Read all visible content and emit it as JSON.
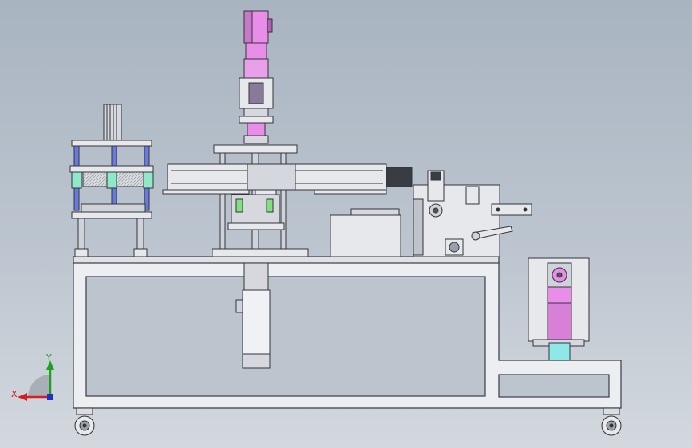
{
  "axes": {
    "x_label": "X",
    "y_label": "Y",
    "colors": {
      "x": "#d42020",
      "y": "#20a020",
      "z": "#2030c8"
    }
  },
  "colors": {
    "frame": "#ecedf0",
    "outline": "#3a3c44",
    "motor": "#e88ee8",
    "motor_dark": "#b060b0",
    "steel": "#c8ccd4",
    "cyan": "#8fe8e8",
    "green": "#7fe07f",
    "blue_rod": "#6a7adc"
  }
}
